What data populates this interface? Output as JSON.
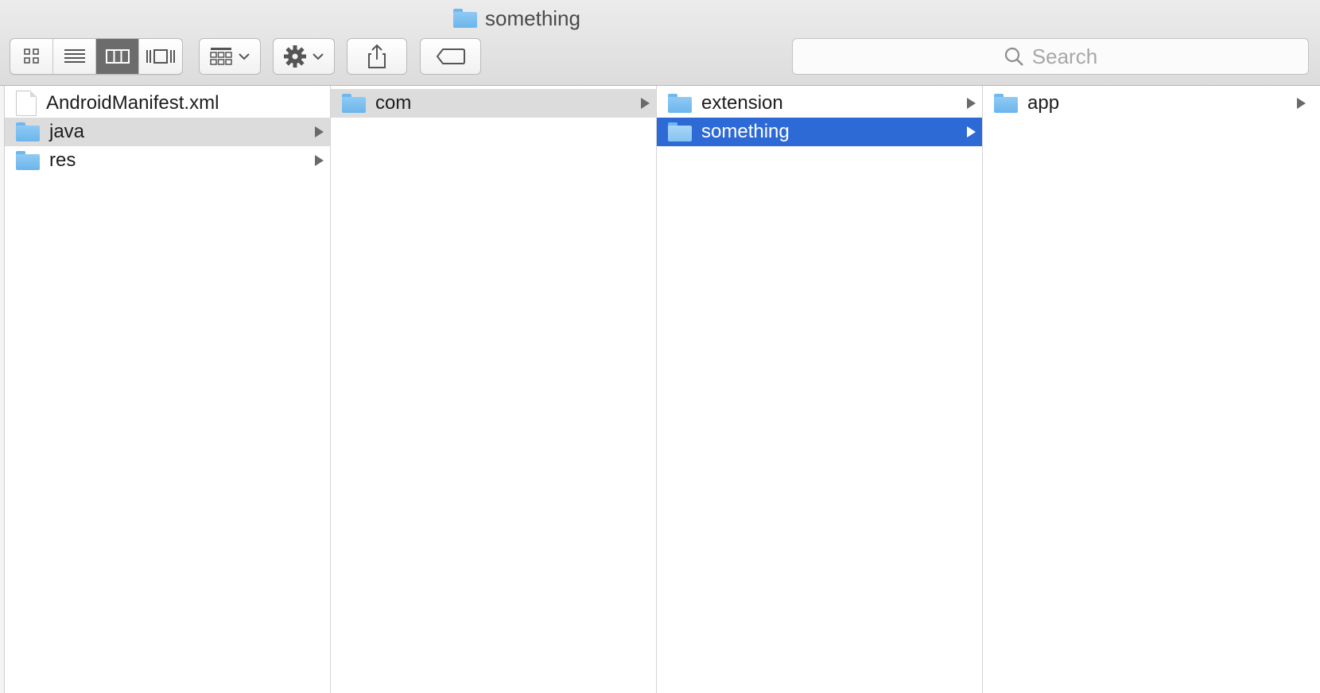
{
  "window": {
    "title": "something"
  },
  "toolbar": {
    "view_modes": [
      {
        "icon": "icon-view-icon",
        "active": false
      },
      {
        "icon": "list-view-icon",
        "active": false
      },
      {
        "icon": "column-view-icon",
        "active": true
      },
      {
        "icon": "cover-flow-icon",
        "active": false
      }
    ],
    "arrange_icon": "arrange-icon",
    "action_icon": "gear-icon",
    "share_icon": "share-icon",
    "tag_icon": "tag-icon"
  },
  "search": {
    "placeholder": "Search"
  },
  "columns": [
    {
      "items": [
        {
          "name": "AndroidManifest.xml",
          "kind": "file",
          "has_children": false,
          "state": "normal"
        },
        {
          "name": "java",
          "kind": "folder",
          "has_children": true,
          "state": "path"
        },
        {
          "name": "res",
          "kind": "folder",
          "has_children": true,
          "state": "normal"
        }
      ]
    },
    {
      "items": [
        {
          "name": "com",
          "kind": "folder",
          "has_children": true,
          "state": "path"
        }
      ]
    },
    {
      "items": [
        {
          "name": "extension",
          "kind": "folder",
          "has_children": true,
          "state": "normal"
        },
        {
          "name": "something",
          "kind": "folder",
          "has_children": true,
          "state": "selected"
        }
      ]
    },
    {
      "items": [
        {
          "name": "app",
          "kind": "folder",
          "has_children": true,
          "state": "normal"
        }
      ]
    }
  ],
  "colors": {
    "selection": "#2e6ad6",
    "path_highlight": "#dcdcdc",
    "folder": "#7ec0f1"
  }
}
